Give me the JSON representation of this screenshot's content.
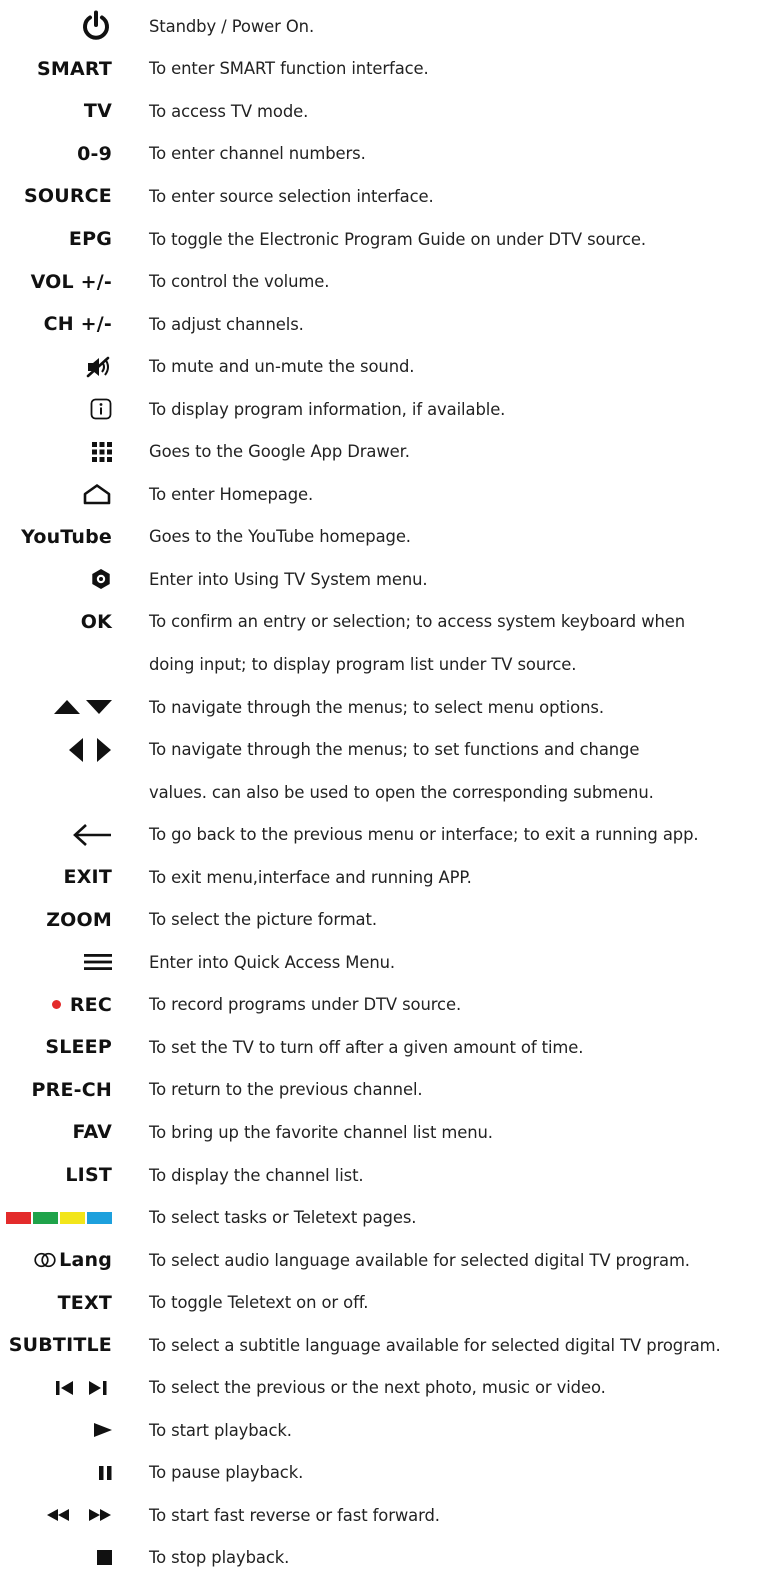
{
  "colors": {
    "red": "#e32b2b",
    "green": "#1fa34a",
    "yellow": "#f2e51a",
    "blue": "#1da0dd"
  },
  "rows": [
    {
      "key": "",
      "icon": "power-icon",
      "desc": "Standby / Power On."
    },
    {
      "key": "SMART",
      "desc": "To enter SMART function interface."
    },
    {
      "key": "TV",
      "desc": "To access TV mode."
    },
    {
      "key": "0-9",
      "desc": "To enter channel numbers."
    },
    {
      "key": "SOURCE",
      "desc": "To enter source selection interface."
    },
    {
      "key": "EPG",
      "desc": "To toggle the Electronic Program Guide on under DTV source."
    },
    {
      "key": "VOL +/-",
      "desc": "To control the volume."
    },
    {
      "key": "CH +/-",
      "desc": "To adjust channels."
    },
    {
      "key": "",
      "icon": "mute-icon",
      "desc": "To mute and un-mute the sound."
    },
    {
      "key": "",
      "icon": "info-icon",
      "desc": "To display program information, if available."
    },
    {
      "key": "",
      "icon": "app-grid-icon",
      "desc": "Goes to the Google App Drawer."
    },
    {
      "key": "",
      "icon": "home-icon",
      "desc": "To enter Homepage."
    },
    {
      "key": "YouTube",
      "desc": "Goes to the YouTube homepage."
    },
    {
      "key": "",
      "icon": "settings-gear-icon",
      "desc": "Enter into Using TV System menu."
    },
    {
      "key": "OK",
      "desc": "To confirm an entry or selection; to access system keyboard when"
    },
    {
      "key": "",
      "desc": "doing input; to display program list under TV source."
    },
    {
      "key": "",
      "icon": "up-down-arrows-icon",
      "desc": "To navigate through the menus; to select menu options."
    },
    {
      "key": "",
      "icon": "left-right-arrows-icon",
      "desc": "To navigate through the menus; to set functions and change"
    },
    {
      "key": "",
      "desc": "values.  can also be used to open the corresponding submenu."
    },
    {
      "key": "",
      "icon": "back-arrow-icon",
      "desc": "To go back to the previous menu or interface; to exit a running app."
    },
    {
      "key": "EXIT",
      "desc": "To exit menu,interface and running APP."
    },
    {
      "key": "ZOOM",
      "desc": "To select the picture format."
    },
    {
      "key": "",
      "icon": "menu-icon",
      "desc": "Enter into Quick Access Menu."
    },
    {
      "key": "REC",
      "icon": "record-dot-icon",
      "desc": "To record programs under DTV source."
    },
    {
      "key": "SLEEP",
      "desc": "To set the TV to turn off after a given amount of time."
    },
    {
      "key": "PRE-CH",
      "desc": "To return to the previous channel."
    },
    {
      "key": "FAV",
      "desc": "To bring up the favorite channel list menu."
    },
    {
      "key": "LIST",
      "desc": "To display the channel list."
    },
    {
      "key": "",
      "icon": "color-buttons-icon",
      "desc": "To select tasks or Teletext pages."
    },
    {
      "key": "Lang",
      "icon": "audio-lang-icon",
      "desc": "To select audio language available for selected digital TV program."
    },
    {
      "key": "TEXT",
      "desc": "To toggle Teletext on or off."
    },
    {
      "key": "SUBTITLE",
      "desc": "To select a subtitle language available for selected digital TV program."
    },
    {
      "key": "",
      "icon": "prev-next-icon",
      "desc": "To select the previous or the next photo, music or video."
    },
    {
      "key": "",
      "icon": "play-icon",
      "desc": "To start playback."
    },
    {
      "key": "",
      "icon": "pause-icon",
      "desc": "To pause playback."
    },
    {
      "key": "",
      "icon": "rewind-forward-icon",
      "desc": "To start fast reverse or fast forward."
    },
    {
      "key": "",
      "icon": "stop-icon",
      "desc": "To stop playback."
    }
  ]
}
